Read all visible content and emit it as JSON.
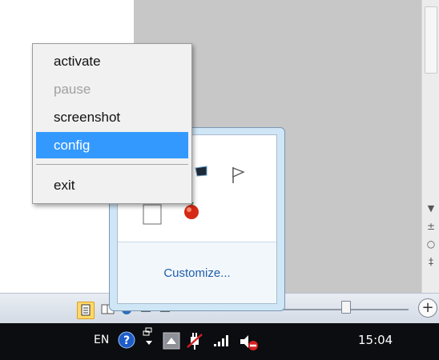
{
  "context_menu": {
    "items": [
      {
        "label": "activate",
        "state": "enabled"
      },
      {
        "label": "pause",
        "state": "disabled"
      },
      {
        "label": "screenshot",
        "state": "enabled"
      },
      {
        "label": "config",
        "state": "highlighted"
      }
    ],
    "exit_label": "exit",
    "highlight_color": "#3399ff"
  },
  "tray_overflow": {
    "customize_label": "Customize...",
    "icons": [
      "monitor-icon",
      "flag-icon",
      "blank-app-icon",
      "red-ball-icon"
    ]
  },
  "statusbar": {
    "view_buttons": [
      "print-layout-icon",
      "full-screen-icon",
      "web-layout-icon",
      "outline-icon",
      "draft-icon"
    ],
    "zoom_in_icon": "plus-circle-icon"
  },
  "taskbar": {
    "language": "EN",
    "clock": "15:04",
    "tray_icons": [
      "help-icon",
      "network-adapters-icon",
      "show-hidden-icons",
      "power-plug-icon",
      "signal-bars-icon",
      "muted-speaker-icon"
    ]
  }
}
